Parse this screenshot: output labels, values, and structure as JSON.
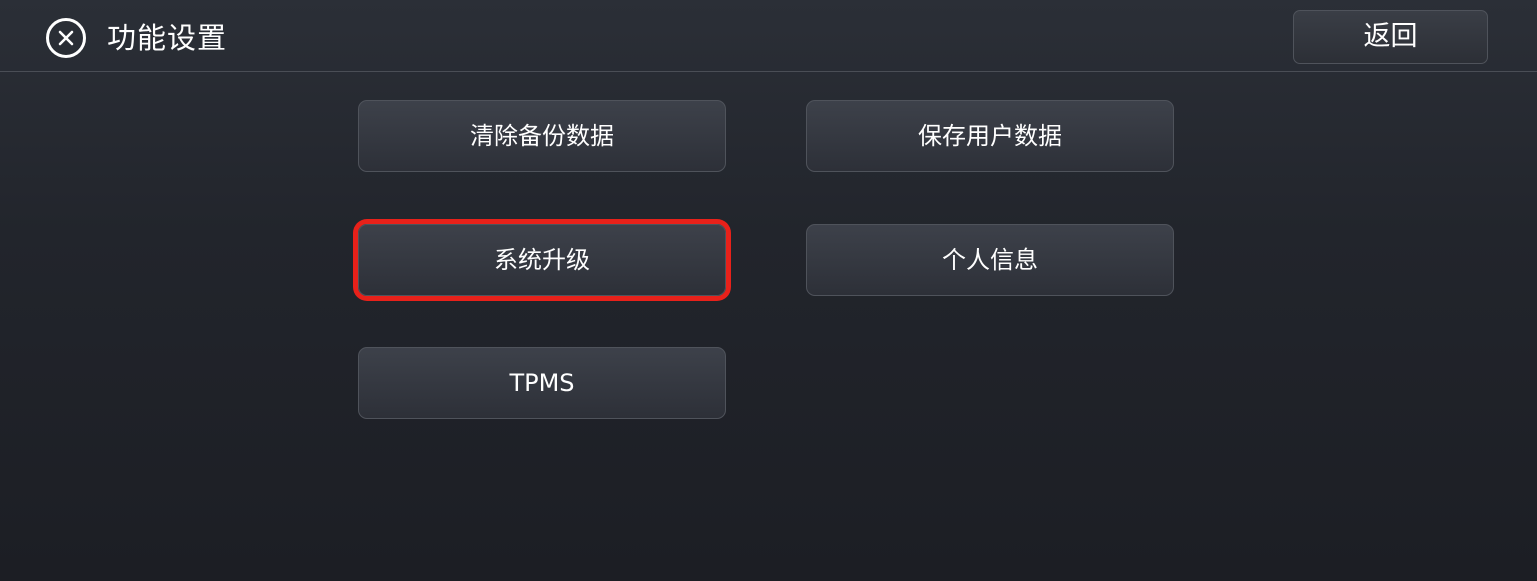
{
  "header": {
    "title": "功能设置",
    "back_label": "返回",
    "close_icon": "close-circle-icon"
  },
  "buttons": [
    {
      "label": "清除备份数据",
      "selected": false
    },
    {
      "label": "保存用户数据",
      "selected": false
    },
    {
      "label": "系统升级",
      "selected": true
    },
    {
      "label": "个人信息",
      "selected": false
    },
    {
      "label": "TPMS",
      "selected": false
    }
  ],
  "colors": {
    "background": "#22252c",
    "button": "#363a42",
    "text": "#ffffff",
    "highlight": "#e8211a"
  }
}
